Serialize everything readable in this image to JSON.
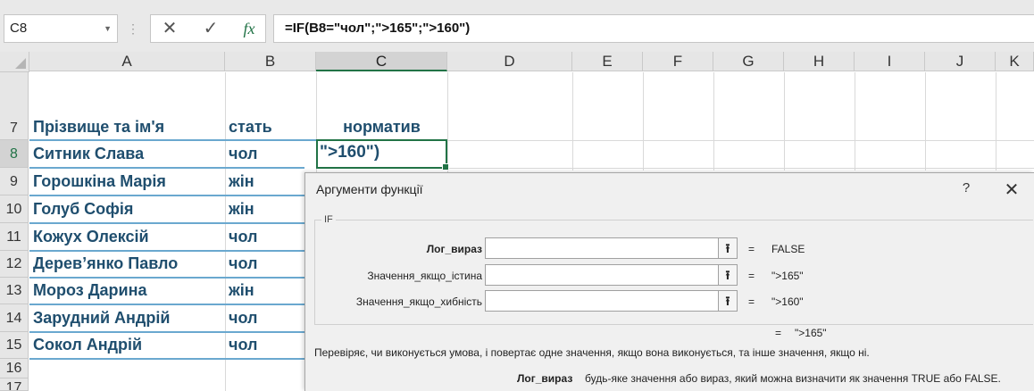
{
  "formula_bar": {
    "name_box": "C8",
    "cancel_icon": "✕",
    "enter_icon": "✓",
    "fx_icon": "fx",
    "formula": "=IF(B8=\"чол\";\">165\";\">160\")"
  },
  "columns": [
    "A",
    "B",
    "C",
    "D",
    "E",
    "F",
    "G",
    "H",
    "I",
    "J",
    "K"
  ],
  "selected_column": "C",
  "rows": [
    "7",
    "8",
    "9",
    "10",
    "11",
    "12",
    "13",
    "14",
    "15",
    "16",
    "17"
  ],
  "selected_row": "8",
  "table": {
    "headers": {
      "name": "Прізвище та ім'я",
      "gender": "стать",
      "norm": "норматив"
    },
    "records": [
      {
        "name": "Ситник Слава",
        "gender": "чол"
      },
      {
        "name": "Горошкіна Марія",
        "gender": "жін"
      },
      {
        "name": "Голуб Софія",
        "gender": "жін"
      },
      {
        "name": "Кожух Олексій",
        "gender": "чол"
      },
      {
        "name": "Дерев’янко Павло",
        "gender": "чол"
      },
      {
        "name": "Мороз Дарина",
        "gender": "жін"
      },
      {
        "name": "Зарудний Андрій",
        "gender": "чол"
      },
      {
        "name": "Сокол Андрій",
        "gender": "чол"
      }
    ],
    "c8_value": "\">160\")"
  },
  "dialog": {
    "title": "Аргументи функції",
    "help": "?",
    "close": "✕",
    "function_name": "IF",
    "args": [
      {
        "label": "Лог_вираз",
        "bold": true,
        "value": "",
        "result": "FALSE"
      },
      {
        "label": "Значення_якщо_істина",
        "bold": false,
        "value": "",
        "result": "\">165\""
      },
      {
        "label": "Значення_якщо_хибність",
        "bold": false,
        "value": "",
        "result": "\">160\""
      }
    ],
    "equals": "=",
    "collapse_icon": "⭱",
    "formula_result": "\">165\"",
    "description": "Перевіряє, чи виконується умова, і повертає одне значення, якщо вона виконується, та інше значення, якщо ні.",
    "arg_help_name": "Лог_вираз",
    "arg_help_text": "будь-яке значення або вираз, який можна визначити як значення TRUE або FALSE."
  },
  "colors": {
    "accent": "#217346",
    "table_text": "#1f4e6e",
    "row_line": "#6aa8cf"
  }
}
